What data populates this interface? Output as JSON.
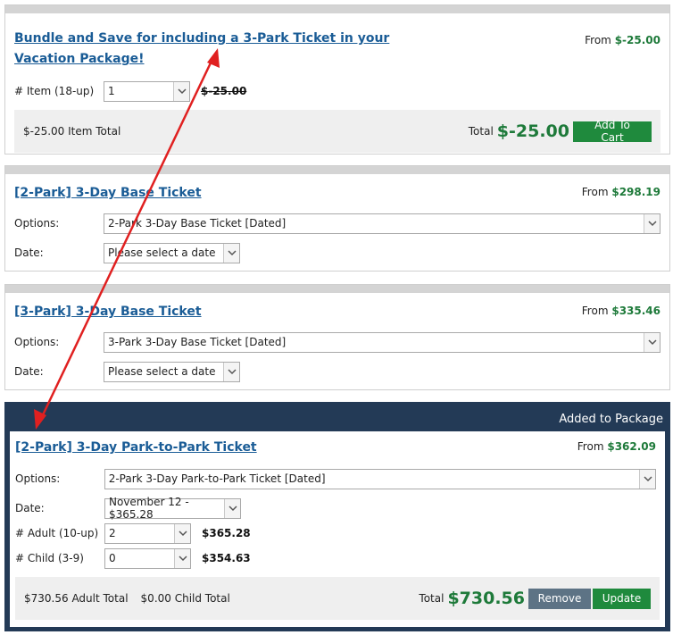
{
  "card1": {
    "title": "Bundle and Save for including a 3-Park Ticket in your Vacation Package!",
    "from_label": "From",
    "from_price": "$-25.00",
    "qty_label": "# Item (18-up)",
    "qty_value": "1",
    "unit_price": "$-25.00",
    "item_total": "$-25.00 Item Total",
    "total_label": "Total",
    "total_value": "$-25.00",
    "add_button": "Add To Cart"
  },
  "card2": {
    "title": "[2-Park] 3-Day Base Ticket",
    "from_label": "From",
    "from_price": "$298.19",
    "options_label": "Options:",
    "options_value": "2-Park 3-Day Base Ticket [Dated]",
    "date_label": "Date:",
    "date_value": "Please select a date"
  },
  "card3": {
    "title": "[3-Park] 3-Day Base Ticket",
    "from_label": "From",
    "from_price": "$335.46",
    "options_label": "Options:",
    "options_value": "3-Park 3-Day Base Ticket [Dated]",
    "date_label": "Date:",
    "date_value": "Please select a date"
  },
  "card4": {
    "header": "Added to Package",
    "title": "[2-Park] 3-Day Park-to-Park Ticket",
    "from_label": "From",
    "from_price": "$362.09",
    "options_label": "Options:",
    "options_value": "2-Park 3-Day Park-to-Park Ticket [Dated]",
    "date_label": "Date:",
    "date_value": "November 12 - $365.28",
    "adult_label": "# Adult (10-up)",
    "adult_value": "2",
    "adult_price": "$365.28",
    "child_label": "# Child (3-9)",
    "child_value": "0",
    "child_price": "$354.63",
    "adult_total": "$730.56 Adult Total",
    "child_total": "$0.00 Child Total",
    "total_label": "Total",
    "total_value": "$730.56",
    "remove_button": "Remove",
    "update_button": "Update"
  },
  "colors": {
    "link": "#1a5c96",
    "price_green": "#1e7a3a",
    "header_navy": "#233a56",
    "annotation_arrow": "#e02020"
  },
  "icons": [
    "chevron-down-icon",
    "red-double-arrow-annotation"
  ]
}
